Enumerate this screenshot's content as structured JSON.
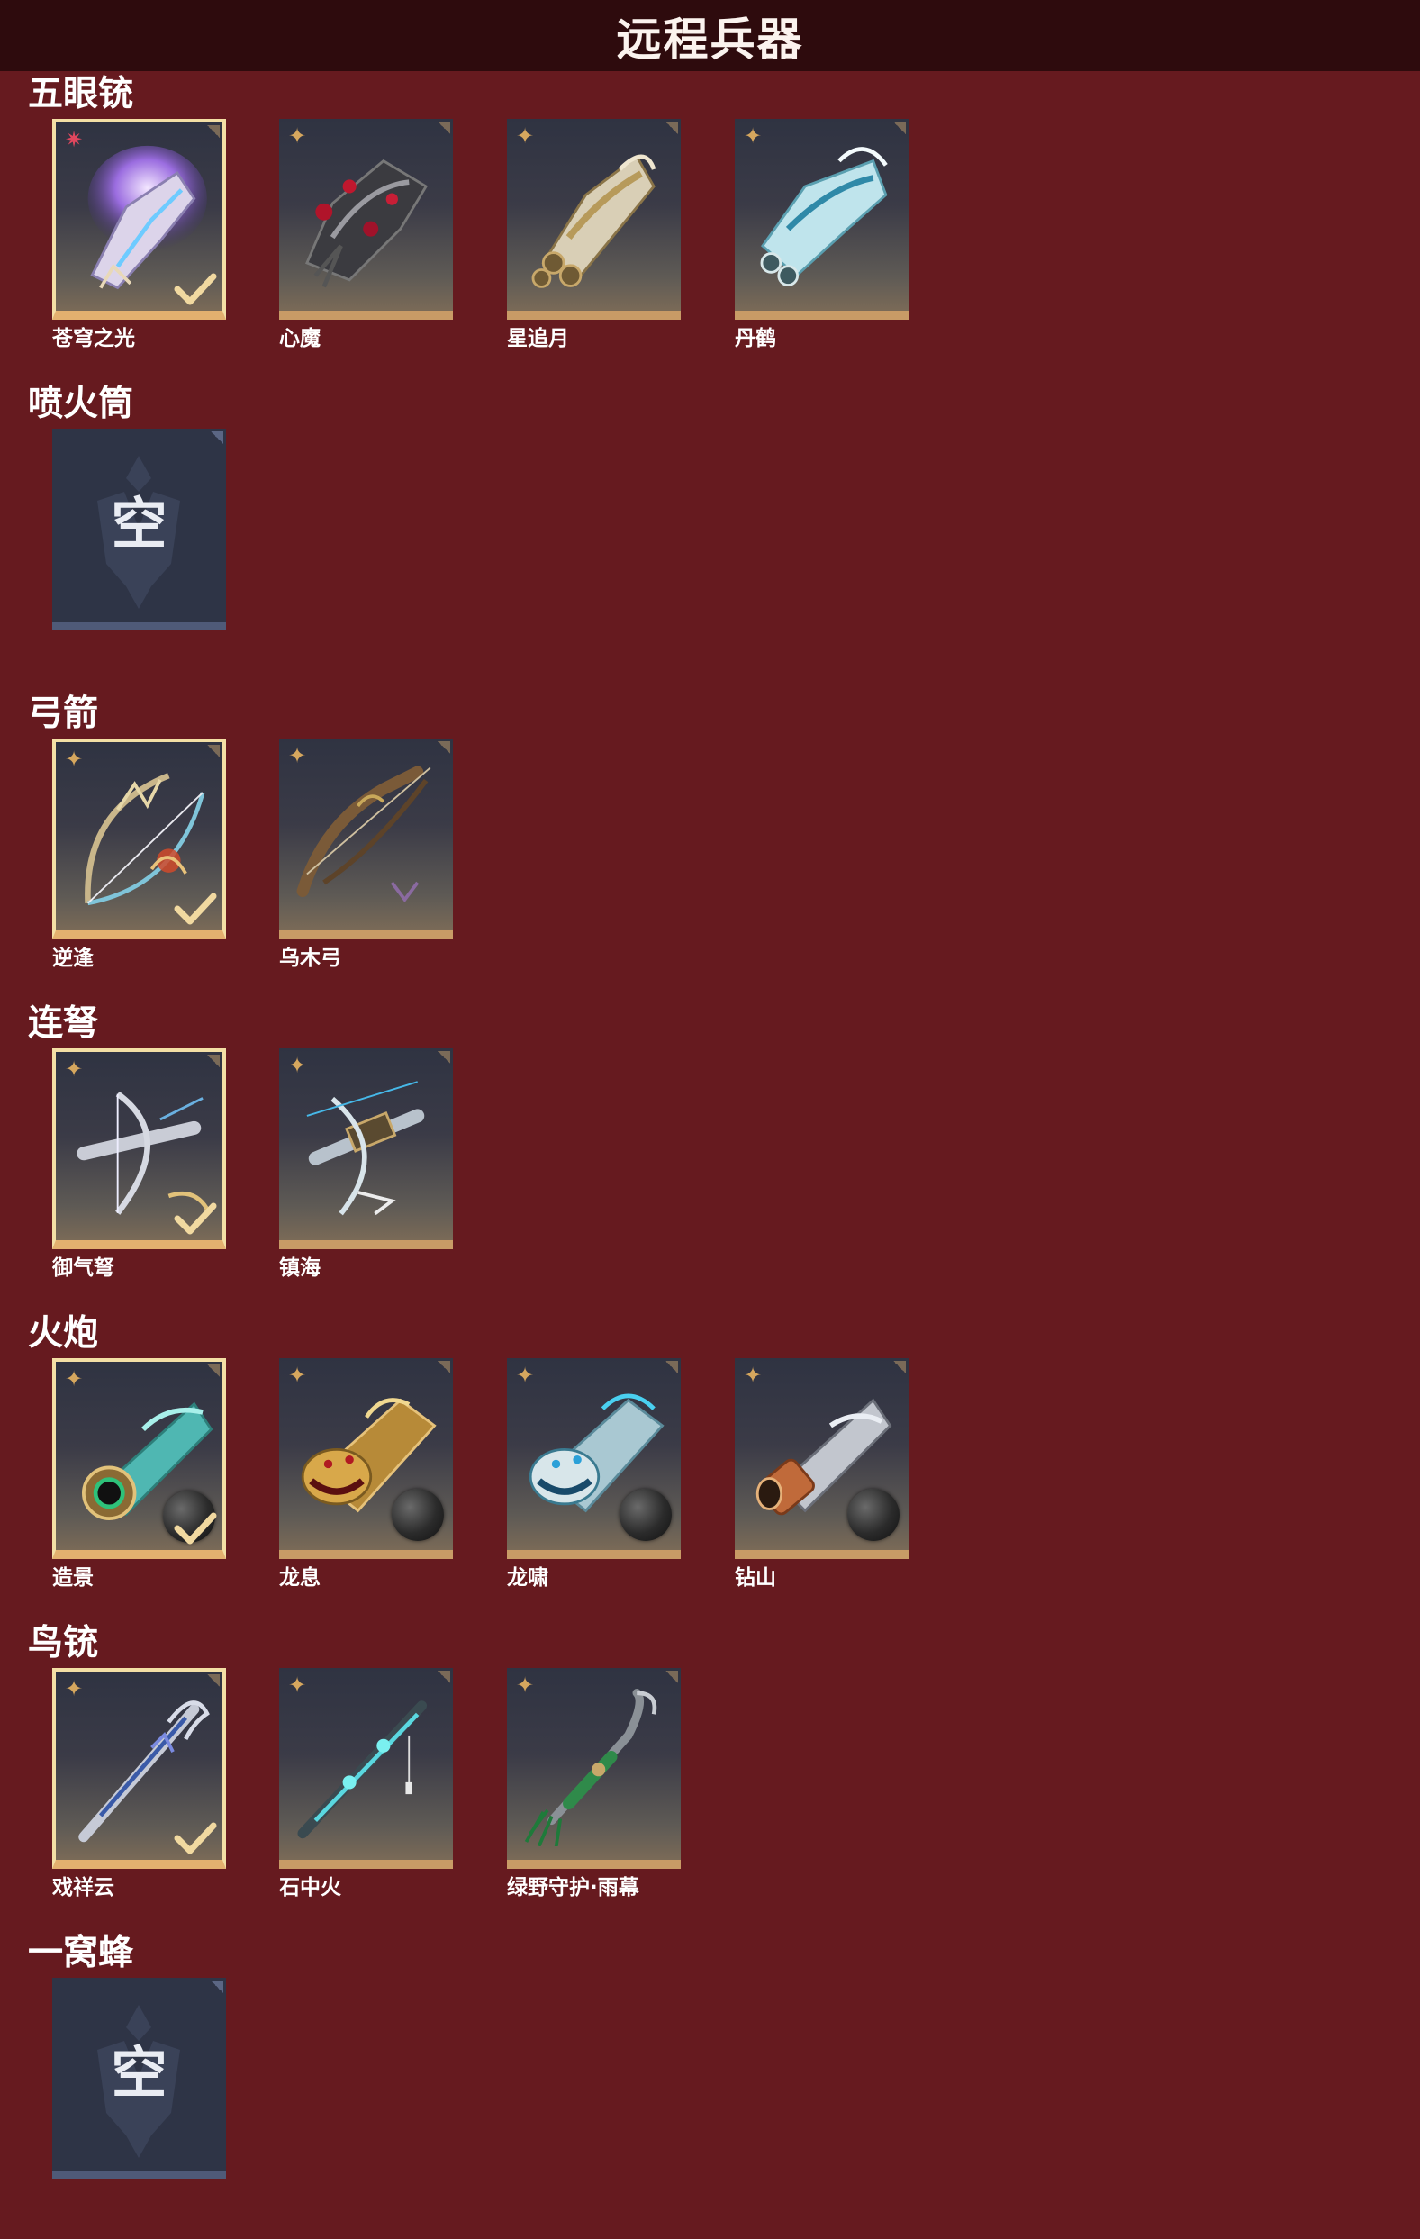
{
  "title": "远程兵器",
  "sections": [
    {
      "name": "五眼铳",
      "items": [
        {
          "name": "苍穹之光",
          "selected": true,
          "rarity": "red",
          "art": "purple-glow-gauntlet"
        },
        {
          "name": "心魔",
          "selected": false,
          "rarity": "gold",
          "art": "dark-red-gauntlet"
        },
        {
          "name": "星追月",
          "selected": false,
          "rarity": "gold",
          "art": "gold-barrel-gauntlet"
        },
        {
          "name": "丹鹤",
          "selected": false,
          "rarity": "gold",
          "art": "cyan-crane-gauntlet"
        }
      ]
    },
    {
      "name": "喷火筒",
      "items": [
        {
          "name": "",
          "empty": true,
          "empty_label": "空"
        }
      ]
    },
    {
      "name": "弓箭",
      "items": [
        {
          "name": "逆逢",
          "selected": true,
          "rarity": "gold",
          "art": "ornate-bow"
        },
        {
          "name": "乌木弓",
          "selected": false,
          "rarity": "gold",
          "art": "wooden-bow"
        }
      ]
    },
    {
      "name": "连弩",
      "items": [
        {
          "name": "御气弩",
          "selected": true,
          "rarity": "gold",
          "art": "silver-crossbow"
        },
        {
          "name": "镇海",
          "selected": false,
          "rarity": "gold",
          "art": "sea-crossbow"
        }
      ]
    },
    {
      "name": "火炮",
      "items": [
        {
          "name": "造景",
          "selected": true,
          "rarity": "gold",
          "art": "jade-cannon",
          "orb": true
        },
        {
          "name": "龙息",
          "selected": false,
          "rarity": "gold",
          "art": "gold-dragon-cannon",
          "orb": true
        },
        {
          "name": "龙啸",
          "selected": false,
          "rarity": "gold",
          "art": "ice-dragon-cannon",
          "orb": true
        },
        {
          "name": "钻山",
          "selected": false,
          "rarity": "gold",
          "art": "copper-cannon",
          "orb": true
        }
      ]
    },
    {
      "name": "鸟铳",
      "items": [
        {
          "name": "戏祥云",
          "selected": true,
          "rarity": "gold",
          "art": "blue-rifle"
        },
        {
          "name": "石中火",
          "selected": false,
          "rarity": "gold",
          "art": "cyan-rifle"
        },
        {
          "name": "绿野守护·雨幕",
          "selected": false,
          "rarity": "gold",
          "art": "green-tassel-rifle"
        }
      ]
    },
    {
      "name": "一窝蜂",
      "items": [
        {
          "name": "",
          "empty": true,
          "empty_label": "空"
        }
      ]
    }
  ],
  "colors": {
    "background": "#661a1f",
    "header": "#2e0b0d",
    "card_bar": "#c89b66",
    "selected_border": "#f3dfa5",
    "empty_card": "#2e3446",
    "rarity_gold": "#d6a75e",
    "rarity_red": "#e0475e"
  }
}
